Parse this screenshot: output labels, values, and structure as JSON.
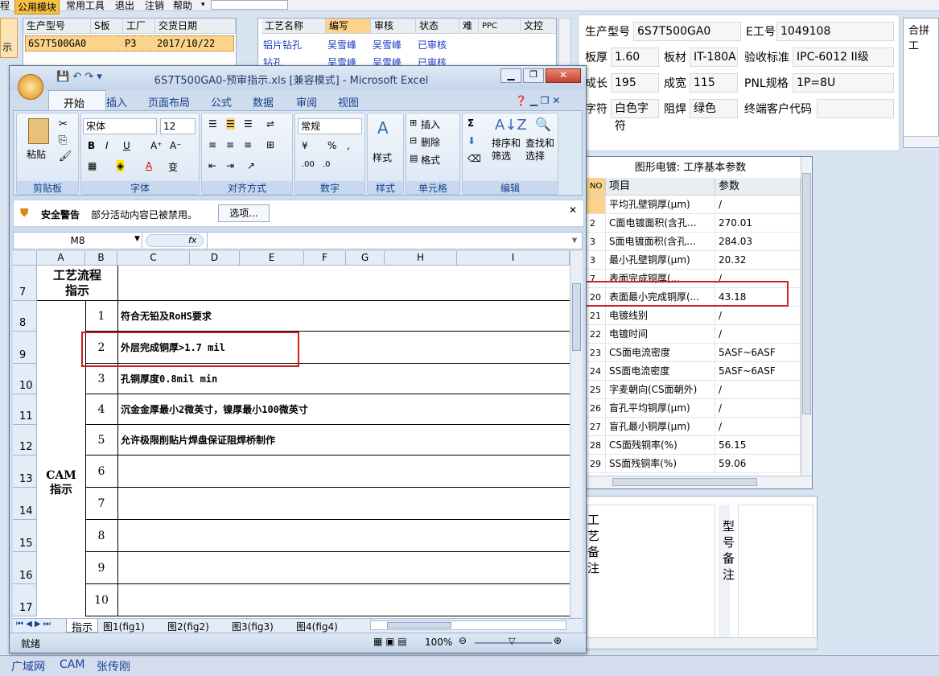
{
  "menubar": {
    "items": [
      "程",
      "公用模块",
      "常用工具",
      "退出",
      "注销",
      "帮助"
    ]
  },
  "left_panel": {
    "headers": [
      "生产型号",
      "S板",
      "工厂",
      "交货日期"
    ],
    "row": [
      "6S7T500GA0",
      "",
      "P3",
      "2017/10/22"
    ],
    "side_label": "示"
  },
  "process_panel": {
    "headers": [
      "工艺名称",
      "编写",
      "审核",
      "状态",
      "难",
      "PPC",
      "文控"
    ],
    "rows": [
      [
        "铝片钻孔",
        "吴雪峰",
        "吴雪峰",
        "已审核"
      ],
      [
        "钻孔",
        "吴雪峰",
        "吴雪峰",
        "已审核"
      ]
    ]
  },
  "info": {
    "labels": [
      "生产型号",
      "E工号",
      "板厚",
      "板材",
      "验收标准",
      "成长",
      "成宽",
      "PNL规格",
      "字符",
      "阻焊",
      "终端客户代码"
    ],
    "values": {
      "model": "6S7T500GA0",
      "eno": "1049108",
      "thickness": "1.60",
      "material": "IT-180A",
      "standard": "IPC-6012 II级",
      "len": "195",
      "width": "115",
      "pnl": "1P=8U",
      "char": "白色字符",
      "solder": "绿色",
      "customer": ""
    },
    "side_tab": "合拼工"
  },
  "params": {
    "title": "图形电镀: 工序基本参数",
    "headers": [
      "NO",
      "项目",
      "参数"
    ],
    "rows": [
      [
        "",
        "平均孔壁铜厚(μm)",
        "/"
      ],
      [
        "2",
        "C面电镀面积(含孔...",
        "270.01"
      ],
      [
        "3",
        "S面电镀面积(含孔...",
        "284.03"
      ],
      [
        "3",
        "最小孔壁铜厚(μm)",
        "20.32"
      ],
      [
        "7",
        "表面完成铜厚(...",
        "/"
      ],
      [
        "20",
        "表面最小完成铜厚(...",
        "43.18"
      ],
      [
        "21",
        "电镀线别",
        "/"
      ],
      [
        "22",
        "电镀时间",
        "/"
      ],
      [
        "23",
        "CS面电流密度",
        "5ASF~6ASF"
      ],
      [
        "24",
        "SS面电流密度",
        "5ASF~6ASF"
      ],
      [
        "25",
        "字麦朝向(CS面朝外)",
        "/"
      ],
      [
        "26",
        "盲孔平均铜厚(μm)",
        "/"
      ],
      [
        "27",
        "盲孔最小铜厚(μm)",
        "/"
      ],
      [
        "28",
        "CS面残铜率(%)",
        "56.15"
      ],
      [
        "29",
        "SS面残铜率(%)",
        "59.06"
      ]
    ]
  },
  "notes": {
    "left": "工艺备注",
    "right": "型号备注"
  },
  "taskbar": [
    "广域网",
    "CAM",
    "张传刚"
  ],
  "excel": {
    "title": "6S7T500GA0-预审指示.xls  [兼容模式] - Microsoft Excel",
    "tabs": [
      "开始",
      "插入",
      "页面布局",
      "公式",
      "数据",
      "审阅",
      "视图"
    ],
    "groups": [
      "剪贴板",
      "字体",
      "对齐方式",
      "数字",
      "样式",
      "单元格",
      "编辑"
    ],
    "font_name": "宋体",
    "font_size": "12",
    "number_format": "常规",
    "paste": "粘贴",
    "style": "样式",
    "cells_btns": [
      "插入",
      "删除",
      "格式"
    ],
    "edit_btns": [
      "排序和",
      "筛选",
      "查找和",
      "选择"
    ],
    "warning_title": "安全警告",
    "warning_text": "部分活动内容已被禁用。",
    "options_btn": "选项...",
    "namebox": "M8",
    "fx": "fx",
    "cols": [
      "A",
      "B",
      "C",
      "D",
      "E",
      "F",
      "G",
      "H",
      "I"
    ],
    "row_header_7": "工艺流程\n指示",
    "cam": "CAM\n指示",
    "rows": [
      {
        "num": "7",
        "n": "",
        "text": ""
      },
      {
        "num": "8",
        "n": "1",
        "text": "符合无铅及RoHS要求"
      },
      {
        "num": "9",
        "n": "2",
        "text": "外层完成铜厚>1.7 mil"
      },
      {
        "num": "10",
        "n": "3",
        "text": "孔铜厚度0.8mil min"
      },
      {
        "num": "11",
        "n": "4",
        "text": "沉金金厚最小2微英寸，镍厚最小100微英寸"
      },
      {
        "num": "12",
        "n": "5",
        "text": "允许极限削贴片焊盘保证阻焊桥制作"
      },
      {
        "num": "13",
        "n": "6",
        "text": ""
      },
      {
        "num": "14",
        "n": "7",
        "text": ""
      },
      {
        "num": "15",
        "n": "8",
        "text": ""
      },
      {
        "num": "16",
        "n": "9",
        "text": ""
      },
      {
        "num": "17",
        "n": "10",
        "text": ""
      }
    ],
    "sheets": [
      "指示",
      "图1(fig1)",
      "图2(fig2)",
      "图3(fig3)",
      "图4(fig4)"
    ],
    "status": "就绪",
    "zoom": "100%"
  }
}
